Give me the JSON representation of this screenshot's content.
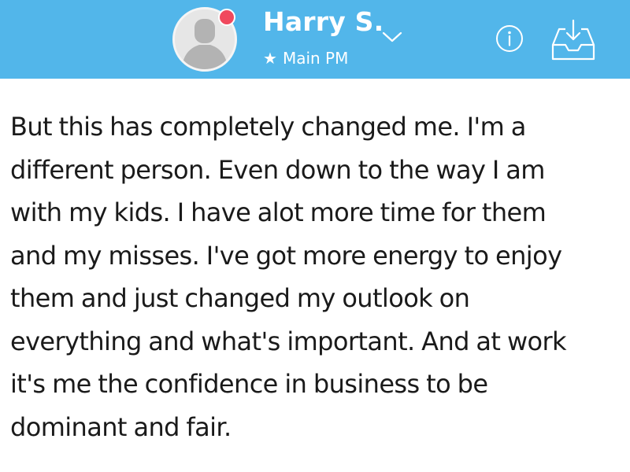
{
  "header": {
    "contact_name": "Harry S.",
    "subtitle_star": "★",
    "subtitle": "Main PM",
    "accent_color": "#52b6ea",
    "status_color": "#f0495e",
    "icons": {
      "avatar": "default-user-avatar",
      "status": "unread-status-dot",
      "dropdown": "chevron-down-icon",
      "info": "info-icon",
      "inbox": "inbox-download-icon"
    }
  },
  "message": {
    "lines": [
      "But this has completely changed me. I'm a",
      "different person. Even down to the way I am",
      "with my kids. I have alot more time for them",
      "and my misses. I've got more energy to enjoy",
      "them and just changed my outlook on",
      "everything and what's important. And at work",
      "it's me the confidence in business to be",
      "dominant and fair."
    ]
  }
}
